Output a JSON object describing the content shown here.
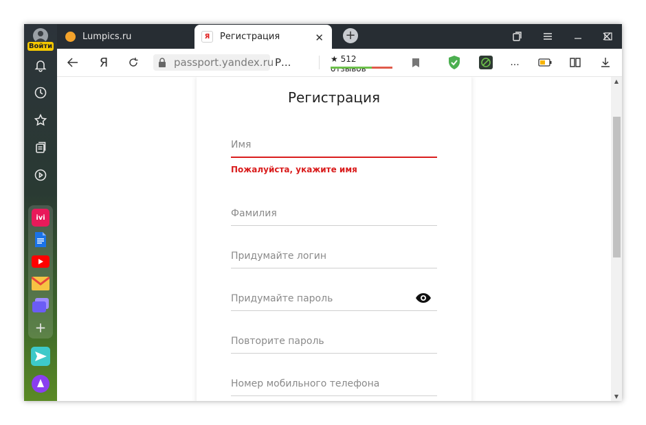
{
  "sidebar": {
    "login_label": "Войти",
    "icons": [
      "bell-icon",
      "history-icon",
      "bookmarks-star-icon",
      "collections-icon",
      "play-icon"
    ],
    "apps": [
      {
        "name": "ivi",
        "label": "ivi",
        "color": "#e8195a"
      },
      {
        "name": "docs",
        "label": "",
        "color": "#1a73e8"
      },
      {
        "name": "youtube",
        "label": "",
        "color": "#ff0000"
      },
      {
        "name": "mail",
        "label": "",
        "color": "#f6c343"
      },
      {
        "name": "gallery",
        "label": "",
        "color": "#6b5cf5"
      }
    ],
    "add_label": "+"
  },
  "tabs": [
    {
      "label": "Lumpics.ru",
      "active": false
    },
    {
      "label": "Регистрация",
      "active": true
    }
  ],
  "address": {
    "ya_label": "Я",
    "url": "passport.yandex.ru",
    "page_abbrev": "Р...",
    "reviews_label": "★ 512 отзывов",
    "more_label": "..."
  },
  "form": {
    "title": "Регистрация",
    "fields": [
      {
        "placeholder": "Имя",
        "error": true
      },
      {
        "placeholder": "Фамилия",
        "error": false
      },
      {
        "placeholder": "Придумайте логин",
        "error": false
      },
      {
        "placeholder": "Придумайте пароль",
        "error": false
      },
      {
        "placeholder": "Повторите пароль",
        "error": false
      },
      {
        "placeholder": "Номер мобильного телефона",
        "error": false
      }
    ],
    "error_message": "Пожалуйста, укажите имя"
  },
  "colors": {
    "error": "#d91c1c",
    "accent_green": "#4caf50"
  }
}
